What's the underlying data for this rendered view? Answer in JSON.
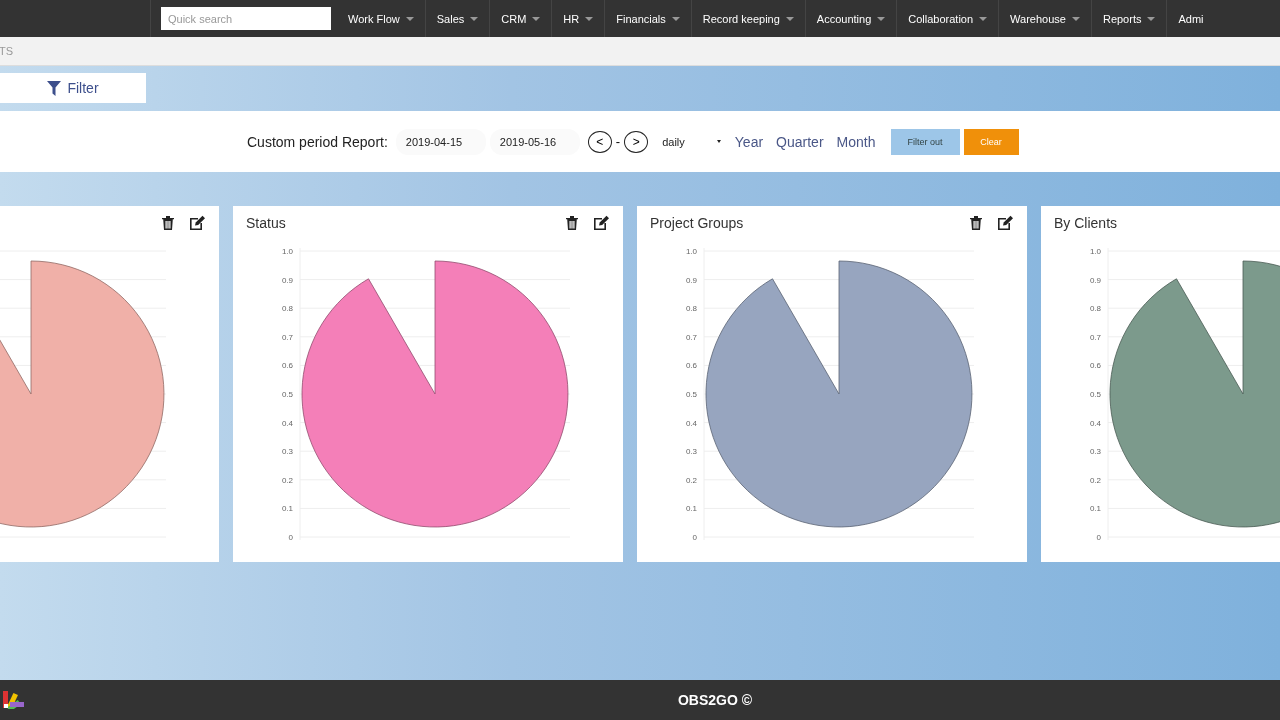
{
  "navbar": {
    "search": {
      "placeholder": "Quick search"
    },
    "menu": [
      {
        "label": "Work Flow"
      },
      {
        "label": "Sales"
      },
      {
        "label": "CRM"
      },
      {
        "label": "HR"
      },
      {
        "label": "Financials"
      },
      {
        "label": "Record keeping"
      },
      {
        "label": "Accounting"
      },
      {
        "label": "Collaboration"
      },
      {
        "label": "Warehouse"
      },
      {
        "label": "Reports"
      },
      {
        "label": "Admi"
      }
    ]
  },
  "breadcrumb": "TS",
  "filter_tab": {
    "label": "Filter"
  },
  "period": {
    "label": "Custom period Report:",
    "from": "2019-04-15",
    "to": "2019-05-16",
    "prev": "<",
    "separator": "-",
    "next": ">",
    "interval": "daily",
    "links": [
      {
        "label": "Year"
      },
      {
        "label": "Quarter"
      },
      {
        "label": "Month"
      }
    ],
    "filter_button": "Filter out",
    "clear_button": "Clear"
  },
  "cards": [
    {
      "actions": true,
      "color": "#f0b0a8"
    },
    {
      "title": "Status",
      "actions": true,
      "color": "#f47fb8",
      "y_ticks": [
        "1.0",
        "0.9",
        "0.8",
        "0.7",
        "0.6",
        "0.5",
        "0.4",
        "0.3",
        "0.2",
        "0.1",
        "0"
      ]
    },
    {
      "title": "Project Groups",
      "actions": true,
      "color": "#97a5bf",
      "y_ticks": [
        "1.0",
        "0.9",
        "0.8",
        "0.7",
        "0.6",
        "0.5",
        "0.4",
        "0.3",
        "0.2",
        "0.1",
        "0"
      ]
    },
    {
      "title": "By Clients",
      "color": "#7c9a8c",
      "y_ticks": [
        "1.0",
        "0.9",
        "0.8",
        "0.7",
        "0.6",
        "0.5",
        "0.4",
        "0.3",
        "0.2",
        "0.1",
        "0"
      ]
    }
  ],
  "footer": {
    "text": "OBS2GO ©"
  }
}
